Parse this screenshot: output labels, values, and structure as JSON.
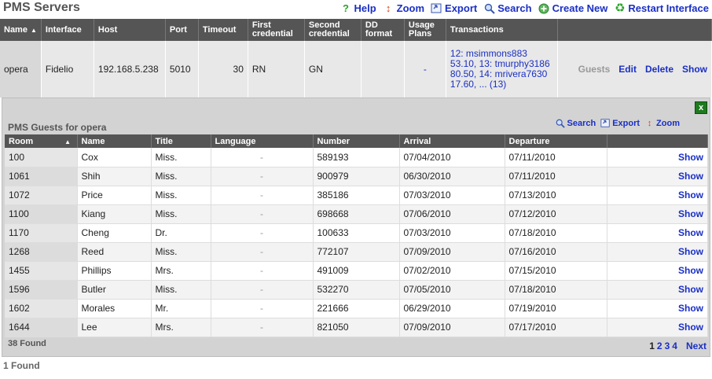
{
  "page": {
    "title": "PMS Servers",
    "found": "1 Found"
  },
  "toolbar": {
    "help": "Help",
    "zoom": "Zoom",
    "export": "Export",
    "search": "Search",
    "create": "Create New",
    "restart": "Restart Interface"
  },
  "servers": {
    "columns": [
      "Name",
      "Interface",
      "Host",
      "Port",
      "Timeout",
      "First credential",
      "Second credential",
      "DD format",
      "Usage Plans",
      "Transactions"
    ],
    "row": {
      "name": "opera",
      "interface": "Fidelio",
      "host": "192.168.5.238",
      "port": "5010",
      "timeout": "30",
      "first_credential": "RN",
      "second_credential": "GN",
      "dd_format": "",
      "usage_plans": "-",
      "transactions": "12: msimmons883 53.10, 13: tmurphy3186 80.50, 14: mrivera7630 17.60, ... (13)",
      "guests": "Guests",
      "edit": "Edit",
      "delete": "Delete",
      "show": "Show"
    }
  },
  "guests_panel": {
    "title": "PMS Guests for opera",
    "close": "x",
    "toolbar": {
      "search": "Search",
      "export": "Export",
      "zoom": "Zoom"
    },
    "columns": [
      "Room",
      "Name",
      "Title",
      "Language",
      "Number",
      "Arrival",
      "Departure"
    ],
    "rows": [
      {
        "room": "100",
        "name": "Cox",
        "title": "Miss.",
        "language": "-",
        "number": "589193",
        "arrival": "07/04/2010",
        "departure": "07/11/2010",
        "action": "Show"
      },
      {
        "room": "1061",
        "name": "Shih",
        "title": "Miss.",
        "language": "-",
        "number": "900979",
        "arrival": "06/30/2010",
        "departure": "07/11/2010",
        "action": "Show"
      },
      {
        "room": "1072",
        "name": "Price",
        "title": "Miss.",
        "language": "-",
        "number": "385186",
        "arrival": "07/03/2010",
        "departure": "07/13/2010",
        "action": "Show"
      },
      {
        "room": "1100",
        "name": "Kiang",
        "title": "Miss.",
        "language": "-",
        "number": "698668",
        "arrival": "07/06/2010",
        "departure": "07/12/2010",
        "action": "Show"
      },
      {
        "room": "1170",
        "name": "Cheng",
        "title": "Dr.",
        "language": "-",
        "number": "100633",
        "arrival": "07/03/2010",
        "departure": "07/18/2010",
        "action": "Show"
      },
      {
        "room": "1268",
        "name": "Reed",
        "title": "Miss.",
        "language": "-",
        "number": "772107",
        "arrival": "07/09/2010",
        "departure": "07/16/2010",
        "action": "Show"
      },
      {
        "room": "1455",
        "name": "Phillips",
        "title": "Mrs.",
        "language": "-",
        "number": "491009",
        "arrival": "07/02/2010",
        "departure": "07/15/2010",
        "action": "Show"
      },
      {
        "room": "1596",
        "name": "Butler",
        "title": "Miss.",
        "language": "-",
        "number": "532270",
        "arrival": "07/05/2010",
        "departure": "07/18/2010",
        "action": "Show"
      },
      {
        "room": "1602",
        "name": "Morales",
        "title": "Mr.",
        "language": "-",
        "number": "221666",
        "arrival": "06/29/2010",
        "departure": "07/19/2010",
        "action": "Show"
      },
      {
        "room": "1644",
        "name": "Lee",
        "title": "Mrs.",
        "language": "-",
        "number": "821050",
        "arrival": "07/09/2010",
        "departure": "07/17/2010",
        "action": "Show"
      }
    ],
    "found": "38 Found",
    "pager": {
      "current": "1",
      "pages": [
        "2",
        "3",
        "4"
      ],
      "next": "Next"
    }
  },
  "colors": {
    "link": "#1a2fc4",
    "header_bg": "#555555",
    "panel_bg": "#d3d3d3",
    "close_green": "#1f7a1f"
  }
}
